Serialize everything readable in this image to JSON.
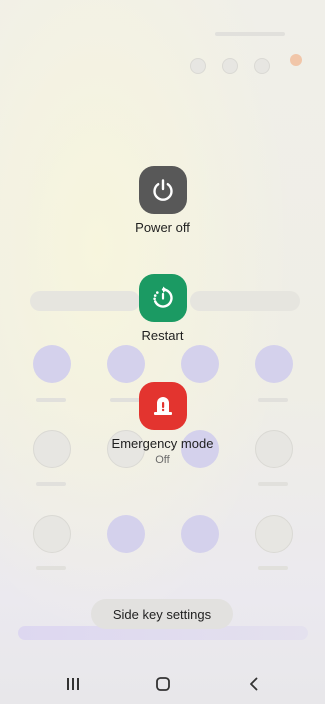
{
  "power_menu": {
    "power_off": {
      "label": "Power off",
      "color": "#585858",
      "icon": "power-icon"
    },
    "restart": {
      "label": "Restart",
      "color": "#1b9a63",
      "icon": "restart-icon"
    },
    "emergency": {
      "label": "Emergency mode",
      "status": "Off",
      "color": "#e3342f",
      "icon": "emergency-light-icon"
    }
  },
  "side_key_settings": {
    "label": "Side key settings"
  },
  "nav_bar": {
    "recents": {
      "icon": "recents-icon"
    },
    "home": {
      "icon": "home-icon"
    },
    "back": {
      "icon": "back-icon"
    }
  }
}
